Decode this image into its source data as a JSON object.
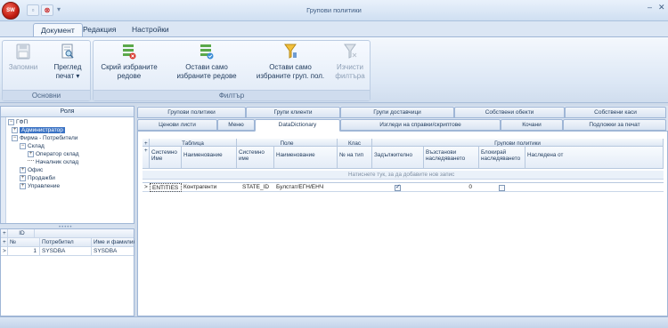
{
  "titlebar": {
    "logo_text": "SW",
    "title": "Групови политики",
    "minimize": "–",
    "close": "✕",
    "qat_close": "⊗"
  },
  "ribbon_tabs": [
    "Документ",
    "Редакция",
    "Настройки"
  ],
  "ribbon": {
    "groups": [
      {
        "caption": "Основни",
        "buttons": [
          {
            "label": "Запомни",
            "icon": "save-icon",
            "disabled": true
          },
          {
            "label": "Преглед печат",
            "icon": "print-preview-icon",
            "disabled": false
          }
        ]
      },
      {
        "caption": "Филтър",
        "buttons": [
          {
            "label": "Скрий избраните редове",
            "icon": "hide-rows-icon",
            "disabled": false
          },
          {
            "label": "Остави само избраните редове",
            "icon": "keep-rows-icon",
            "disabled": false
          },
          {
            "label": "Остави само избраните груп. пол.",
            "icon": "filter-groups-icon",
            "disabled": false
          },
          {
            "label": "Изчисти филтъра",
            "icon": "clear-filter-icon",
            "disabled": true
          }
        ]
      }
    ],
    "btn1_line1": "Запомни",
    "btn2_line1": "Преглед",
    "btn2_line2": "печат",
    "btn3_line1": "Скрий избраните",
    "btn3_line2": "редове",
    "btn4_line1": "Остави само",
    "btn4_line2": "избраните редове",
    "btn5_line1": "Остави само",
    "btn5_line2": "избраните груп. пол.",
    "btn6_line1": "Изчисти",
    "btn6_line2": "филтъра"
  },
  "roles_panel": {
    "header": "Роля",
    "tree": [
      {
        "label": "ГФП",
        "sym": "⊟"
      },
      {
        "label": "Администратор",
        "sym": "⊞",
        "selected": true
      },
      {
        "label": "Фирма - Потребители",
        "sym": "⊟"
      },
      {
        "label": "Склад",
        "sym": "⊟"
      },
      {
        "label": "Оператор склад",
        "sym": "⊞"
      },
      {
        "label": "Началник склад",
        "sym": ""
      },
      {
        "label": "Офис",
        "sym": "⊞"
      },
      {
        "label": "Продажби",
        "sym": "⊞"
      },
      {
        "label": "Управление",
        "sym": "⊞"
      }
    ]
  },
  "users_panel": {
    "id_header": "ID",
    "columns": [
      "№",
      "Потребител",
      "Име и фамилия"
    ],
    "rows": [
      {
        "num": "1",
        "user": "SYSDBA",
        "name": "SYSDBA"
      }
    ]
  },
  "tabs_row1": [
    "Групови политики",
    "Групи клиенти",
    "Групи доставчици",
    "Собствени обекти",
    "Собствени каси"
  ],
  "tabs_row2": [
    "Ценови листи",
    "Меню",
    "DataDictionary",
    "Изгледи на справки/скриптове",
    "Кочани",
    "Подложки за печат"
  ],
  "grid": {
    "bands": {
      "table": "Таблица",
      "field": "Поле",
      "class": "Клас",
      "policies": "Групови политики"
    },
    "columns": {
      "sys_name": "Системно Име",
      "t_name": "Наименование",
      "f_sys": "Системно име",
      "f_name": "Наименование",
      "type_no": "№ на тип",
      "mandatory": "Задължително",
      "restore": "Възстанови наследяването",
      "block": "Блокирай наследяването",
      "inherited": "Наследена от"
    },
    "new_row": "Натиснете тук, за да добавите нов запис",
    "rows": [
      {
        "sys_name": "ENTITIES",
        "t_name": "Контрагенти",
        "f_sys": "STATE_ID",
        "f_name": "Булстат/ЕГН/ЕНЧ",
        "type_no": "",
        "mandatory": true,
        "restore": "0",
        "block": false,
        "inherited": ""
      }
    ]
  }
}
